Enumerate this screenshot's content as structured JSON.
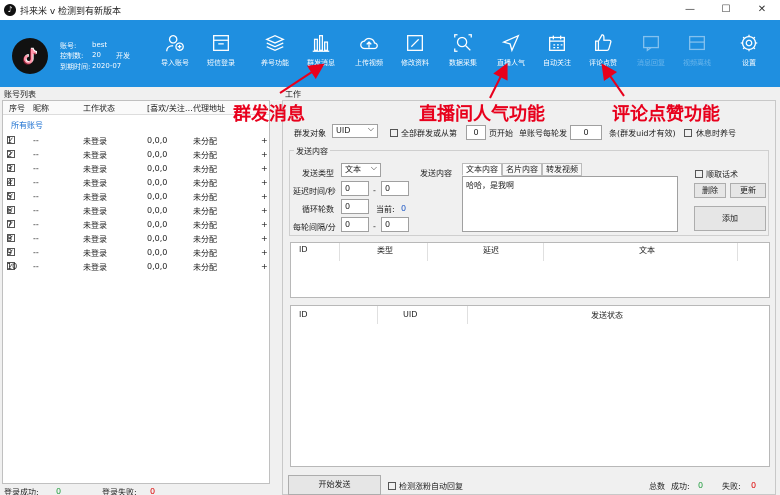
{
  "window": {
    "title": "抖来米 v 检测到有新版本",
    "minimize": "—",
    "maximize": "☐",
    "close": "✕"
  },
  "account": {
    "label_account": "账号:",
    "account_value": "best",
    "label_control": "控制数:",
    "control_value": "20",
    "open_label": "开发",
    "label_expire": "到期时间:",
    "expire_value": "2020-07"
  },
  "toolbar": {
    "buttons": [
      {
        "label": "导入账号",
        "icon": "user-plus-icon"
      },
      {
        "label": "短信登录",
        "icon": "message-box-icon"
      },
      {
        "label": "养号功能",
        "icon": "layers-icon"
      },
      {
        "label": "群发消息",
        "icon": "bar-chart-icon"
      },
      {
        "label": "上传视频",
        "icon": "cloud-upload-icon"
      },
      {
        "label": "修改资料",
        "icon": "edit-icon"
      },
      {
        "label": "数据采集",
        "icon": "scan-search-icon"
      },
      {
        "label": "直播人气",
        "icon": "send-icon"
      },
      {
        "label": "自动关注",
        "icon": "calendar-icon"
      },
      {
        "label": "评论点赞",
        "icon": "thumbs-up-icon"
      },
      {
        "label": "消息回复",
        "icon": "chat-icon"
      },
      {
        "label": "视频离线",
        "icon": "video-icon"
      },
      {
        "label": "设置",
        "icon": "gear-icon"
      }
    ]
  },
  "annotations": [
    {
      "text": "群发消息"
    },
    {
      "text": "直播间人气功能"
    },
    {
      "text": "评论点赞功能"
    }
  ],
  "left_panel": {
    "title": "账号列表",
    "columns": [
      "序号",
      "昵称",
      "工作状态",
      "[喜欢/关注…",
      "代理地址"
    ],
    "group_label": "所有账号",
    "rows": [
      {
        "index": "1",
        "nick": "--",
        "status": "未登录",
        "like": "0,0,0",
        "proxy": "未分配",
        "plus": "+"
      },
      {
        "index": "2",
        "nick": "--",
        "status": "未登录",
        "like": "0,0,0",
        "proxy": "未分配",
        "plus": "+"
      },
      {
        "index": "3",
        "nick": "--",
        "status": "未登录",
        "like": "0,0,0",
        "proxy": "未分配",
        "plus": "+"
      },
      {
        "index": "4",
        "nick": "--",
        "status": "未登录",
        "like": "0,0,0",
        "proxy": "未分配",
        "plus": "+"
      },
      {
        "index": "5",
        "nick": "--",
        "status": "未登录",
        "like": "0,0,0",
        "proxy": "未分配",
        "plus": "+"
      },
      {
        "index": "6",
        "nick": "--",
        "status": "未登录",
        "like": "0,0,0",
        "proxy": "未分配",
        "plus": "+"
      },
      {
        "index": "7",
        "nick": "--",
        "status": "未登录",
        "like": "0,0,0",
        "proxy": "未分配",
        "plus": "+"
      },
      {
        "index": "8",
        "nick": "--",
        "status": "未登录",
        "like": "0,0,0",
        "proxy": "未分配",
        "plus": "+"
      },
      {
        "index": "9",
        "nick": "--",
        "status": "未登录",
        "like": "0,0,0",
        "proxy": "未分配",
        "plus": "+"
      },
      {
        "index": "10",
        "nick": "--",
        "status": "未登录",
        "like": "0,0,0",
        "proxy": "未分配",
        "plus": "+"
      }
    ],
    "footer_success_label": "登录成功:",
    "footer_success_value": "0",
    "footer_fail_label": "登录失败:",
    "footer_fail_value": "0"
  },
  "work": {
    "label": "工作",
    "target_label": "群发对象",
    "target_value": "UID",
    "all_checkbox": "全部群发或从第",
    "start_page_value": "0",
    "start_page_label": "页开始",
    "per_round_label": "单账号每轮发",
    "per_round_value": "0",
    "per_round_unit": "条(群发uid才有效)",
    "rest_checkbox": "休息时养号",
    "content_group": "发送内容",
    "send_type_label": "发送类型",
    "send_type_value": "文本",
    "send_content_label": "发送内容",
    "delay_label": "延迟时间/秒",
    "delay_min": "0",
    "delay_dash": "-",
    "delay_max": "0",
    "loop_label": "循环轮数",
    "loop_value": "0",
    "current_label": "当前:",
    "current_value": "0",
    "interval_label": "每轮间隔/分",
    "interval_min": "0",
    "interval_dash": "-",
    "interval_max": "0",
    "tabs": [
      "文本内容",
      "名片内容",
      "转发视频"
    ],
    "text_content": "哈哈，是我啊",
    "order_checkbox": "顺取话术",
    "delete_button": "删除",
    "update_button": "更新",
    "add_button": "添加",
    "table1_columns": [
      "ID",
      "类型",
      "延迟",
      "文本"
    ],
    "table2_columns": [
      "ID",
      "UID",
      "发送状态"
    ],
    "start_button": "开始发送",
    "detect_checkbox": "检测涨粉自动回复",
    "total_label": "总数",
    "success_label": "成功:",
    "success_value": "0",
    "fail_label": "失败:",
    "fail_value": "0"
  },
  "colors": {
    "toolbar_blue": "#1f8fe0",
    "annotation_red": "#e8001c"
  }
}
